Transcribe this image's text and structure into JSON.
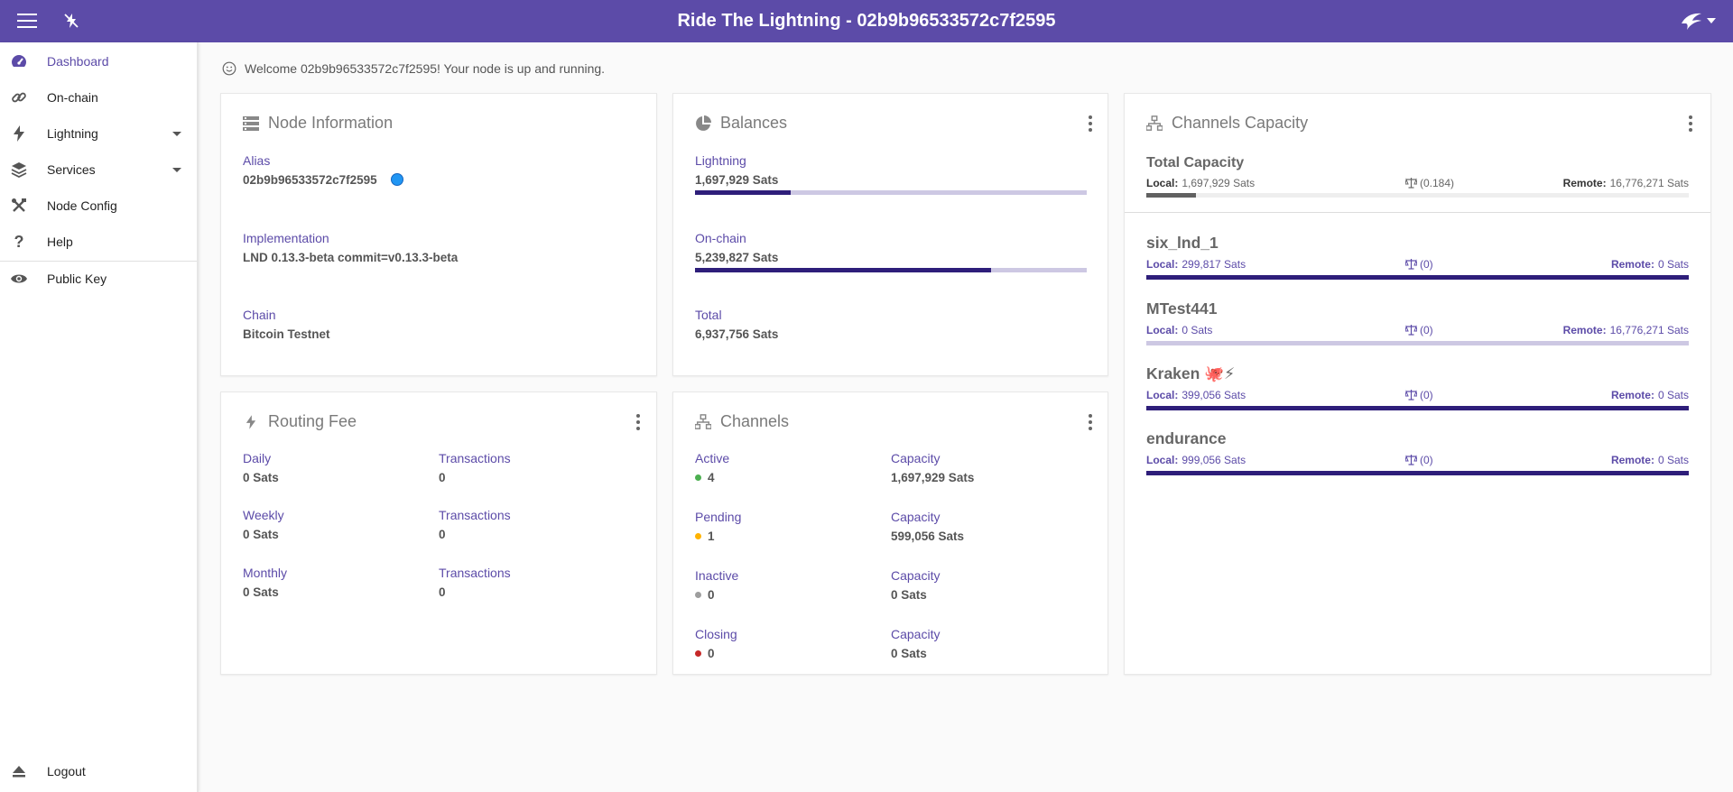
{
  "app": {
    "title": "Ride The Lightning - 02b9b96533572c7f2595"
  },
  "sidebar": {
    "items": [
      {
        "label": "Dashboard",
        "icon": "dashboard-icon"
      },
      {
        "label": "On-chain",
        "icon": "link-icon"
      },
      {
        "label": "Lightning",
        "icon": "bolt-icon"
      },
      {
        "label": "Services",
        "icon": "layers-icon"
      },
      {
        "label": "Node Config",
        "icon": "tools-icon"
      },
      {
        "label": "Help",
        "icon": "question-icon"
      },
      {
        "label": "Public Key",
        "icon": "eye-icon"
      },
      {
        "label": "Logout",
        "icon": "eject-icon"
      }
    ]
  },
  "welcome": {
    "text": "Welcome 02b9b96533572c7f2595! Your node is up and running."
  },
  "node_info": {
    "title": "Node Information",
    "alias_label": "Alias",
    "alias_value": "02b9b96533572c7f2595",
    "alias_color": "#2196f3",
    "impl_label": "Implementation",
    "impl_value": "LND 0.13.3-beta commit=v0.13.3-beta",
    "chain_label": "Chain",
    "chain_value": "Bitcoin Testnet"
  },
  "balances": {
    "title": "Balances",
    "lightning_label": "Lightning",
    "lightning_value": "1,697,929 Sats",
    "lightning_fraction": 0.245,
    "onchain_label": "On-chain",
    "onchain_value": "5,239,827 Sats",
    "onchain_fraction": 0.755,
    "total_label": "Total",
    "total_value": "6,937,756 Sats"
  },
  "routing_fee": {
    "title": "Routing Fee",
    "rows": [
      {
        "label": "Daily",
        "value": "0 Sats",
        "tx_label": "Transactions",
        "tx_value": "0"
      },
      {
        "label": "Weekly",
        "value": "0 Sats",
        "tx_label": "Transactions",
        "tx_value": "0"
      },
      {
        "label": "Monthly",
        "value": "0 Sats",
        "tx_label": "Transactions",
        "tx_value": "0"
      }
    ]
  },
  "channels": {
    "title": "Channels",
    "rows": [
      {
        "label": "Active",
        "count": "4",
        "color": "#4caf50",
        "cap_label": "Capacity",
        "cap_value": "1,697,929 Sats"
      },
      {
        "label": "Pending",
        "count": "1",
        "color": "#ffb300",
        "cap_label": "Capacity",
        "cap_value": "599,056 Sats"
      },
      {
        "label": "Inactive",
        "count": "0",
        "color": "#9e9e9e",
        "cap_label": "Capacity",
        "cap_value": "0 Sats"
      },
      {
        "label": "Closing",
        "count": "0",
        "color": "#c62828",
        "cap_label": "Capacity",
        "cap_value": "0 Sats"
      }
    ]
  },
  "capacity": {
    "title": "Channels Capacity",
    "total_label": "Total Capacity",
    "local_label": "Local:",
    "remote_label": "Remote:",
    "total_local": "1,697,929 Sats",
    "total_ratio": "(0.184)",
    "total_remote": "16,776,271 Sats",
    "total_fraction": 0.092,
    "channels": [
      {
        "name": "six_lnd_1",
        "local": "299,817 Sats",
        "ratio": "(0)",
        "remote": "0 Sats",
        "fraction": 1.0
      },
      {
        "name": "MTest441",
        "local": "0 Sats",
        "ratio": "(0)",
        "remote": "16,776,271 Sats",
        "fraction": 0.0
      },
      {
        "name": "Kraken 🐙⚡",
        "local": "399,056 Sats",
        "ratio": "(0)",
        "remote": "0 Sats",
        "fraction": 1.0
      },
      {
        "name": "endurance",
        "local": "999,056 Sats",
        "ratio": "(0)",
        "remote": "0 Sats",
        "fraction": 1.0
      }
    ]
  }
}
